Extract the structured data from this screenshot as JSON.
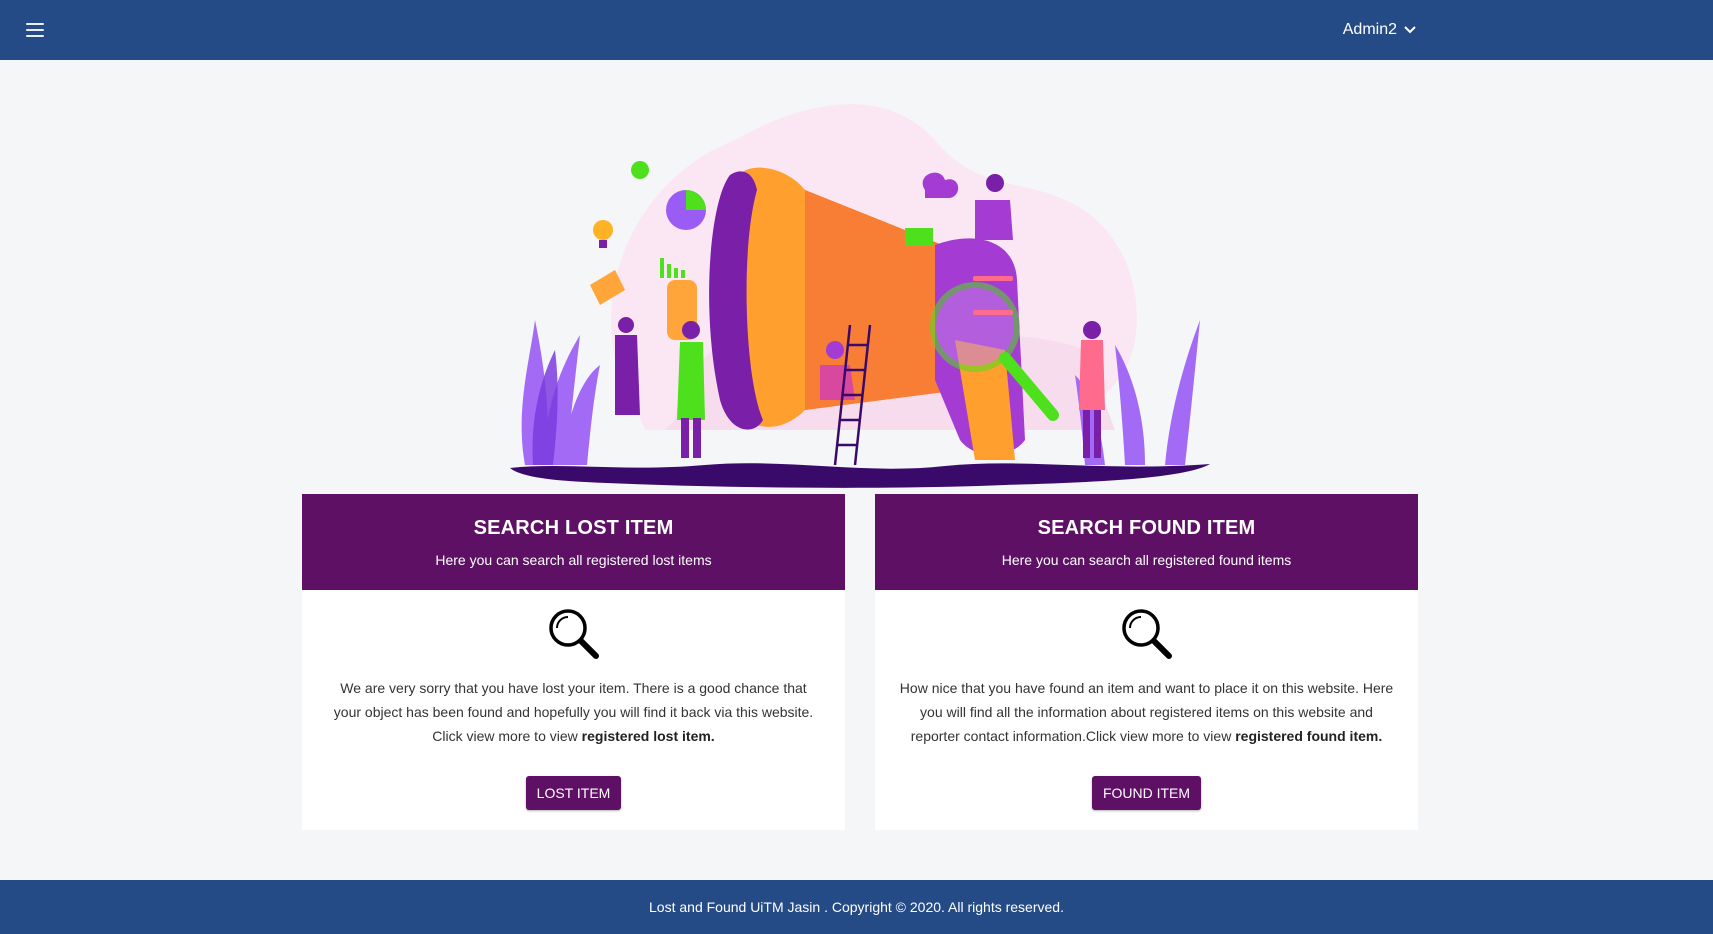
{
  "navbar": {
    "user_name": "Admin2",
    "menu_icon": "hamburger-icon",
    "dropdown_icon": "chevron-down-icon",
    "color": "#254b86"
  },
  "hero": {
    "illustration": "megaphone-illustration"
  },
  "cards": [
    {
      "title": "SEARCH LOST ITEM",
      "subtitle": "Here you can search all registered lost items",
      "icon": "magnifier-icon",
      "text_prefix": "We are very sorry that you have lost your item. There is a good chance that your object has been found and hopefully you will find it back via this website. Click view more to view ",
      "text_bold": "registered lost item.",
      "button_label": "LOST ITEM"
    },
    {
      "title": "SEARCH FOUND ITEM",
      "subtitle": "Here you can search all registered found items",
      "icon": "magnifier-icon",
      "text_prefix": "How nice that you have found an item and want to place it on this website. Here you will find all the information about registered items on this website and reporter contact information.Click view more to view ",
      "text_bold": "registered found item.",
      "button_label": "FOUND ITEM"
    }
  ],
  "footer": {
    "text": "Lost and Found UiTM Jasin . Copyright © 2020. All rights reserved."
  },
  "colors": {
    "accent": "#5e1065",
    "bar": "#254b86",
    "background": "#f5f6f8"
  }
}
